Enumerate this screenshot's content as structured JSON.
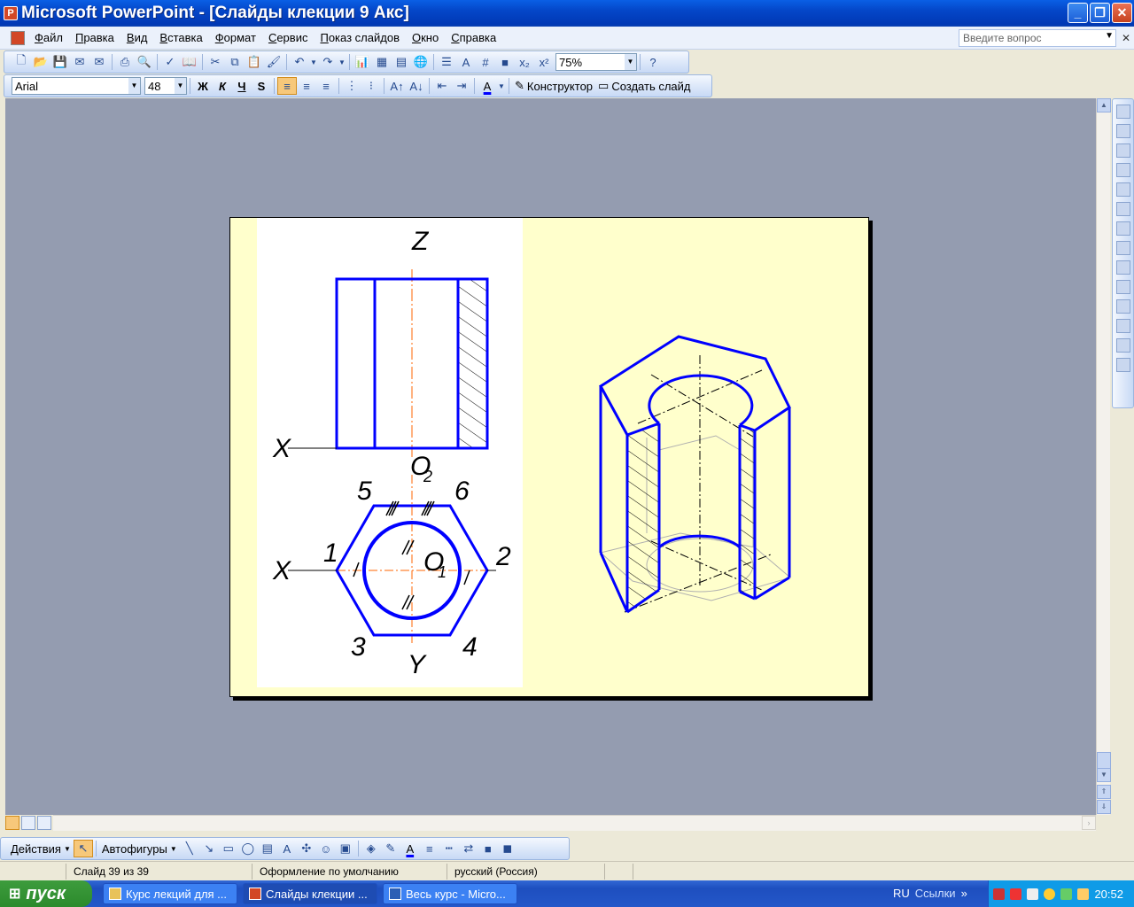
{
  "window": {
    "title": "Microsoft PowerPoint - [Слайды клекции 9 Акс]",
    "minimize": "_",
    "maximize": "❐",
    "close": "✕"
  },
  "menu": {
    "items": [
      "Файл",
      "Правка",
      "Вид",
      "Вставка",
      "Формат",
      "Сервис",
      "Показ слайдов",
      "Окно",
      "Справка"
    ],
    "help_placeholder": "Введите вопрос"
  },
  "standard_toolbar": {
    "zoom": "75%"
  },
  "format_toolbar": {
    "font": "Arial",
    "size": "48",
    "bold": "Ж",
    "italic": "К",
    "underline": "Ч",
    "shadow": "S",
    "designer": "Конструктор",
    "new_slide": "Создать слайд"
  },
  "drawing": {
    "labels": {
      "z": "Z",
      "x_top": "X",
      "o2": "O",
      "o2_sub": "2",
      "n5": "5",
      "n6": "6",
      "n1": "1",
      "n2": "2",
      "x_bottom": "X",
      "o1": "O",
      "o1_sub": "1",
      "n3": "3",
      "n4": "4",
      "y": "Y"
    },
    "colors": {
      "outline": "#0000ff",
      "axis": "#ff6600",
      "slide_bg": "#ffffcc"
    }
  },
  "draw_toolbar": {
    "actions": "Действия",
    "autoshapes": "Автофигуры"
  },
  "status": {
    "slide": "Слайд 39 из 39",
    "design": "Оформление по умолчанию",
    "language": "русский (Россия)"
  },
  "taskbar": {
    "start": "пуск",
    "tasks": [
      "Курс лекций для ...",
      "Слайды клекции ...",
      "Весь курс - Micro..."
    ],
    "lang": "RU",
    "links": "Ссылки",
    "time": "20:52"
  }
}
